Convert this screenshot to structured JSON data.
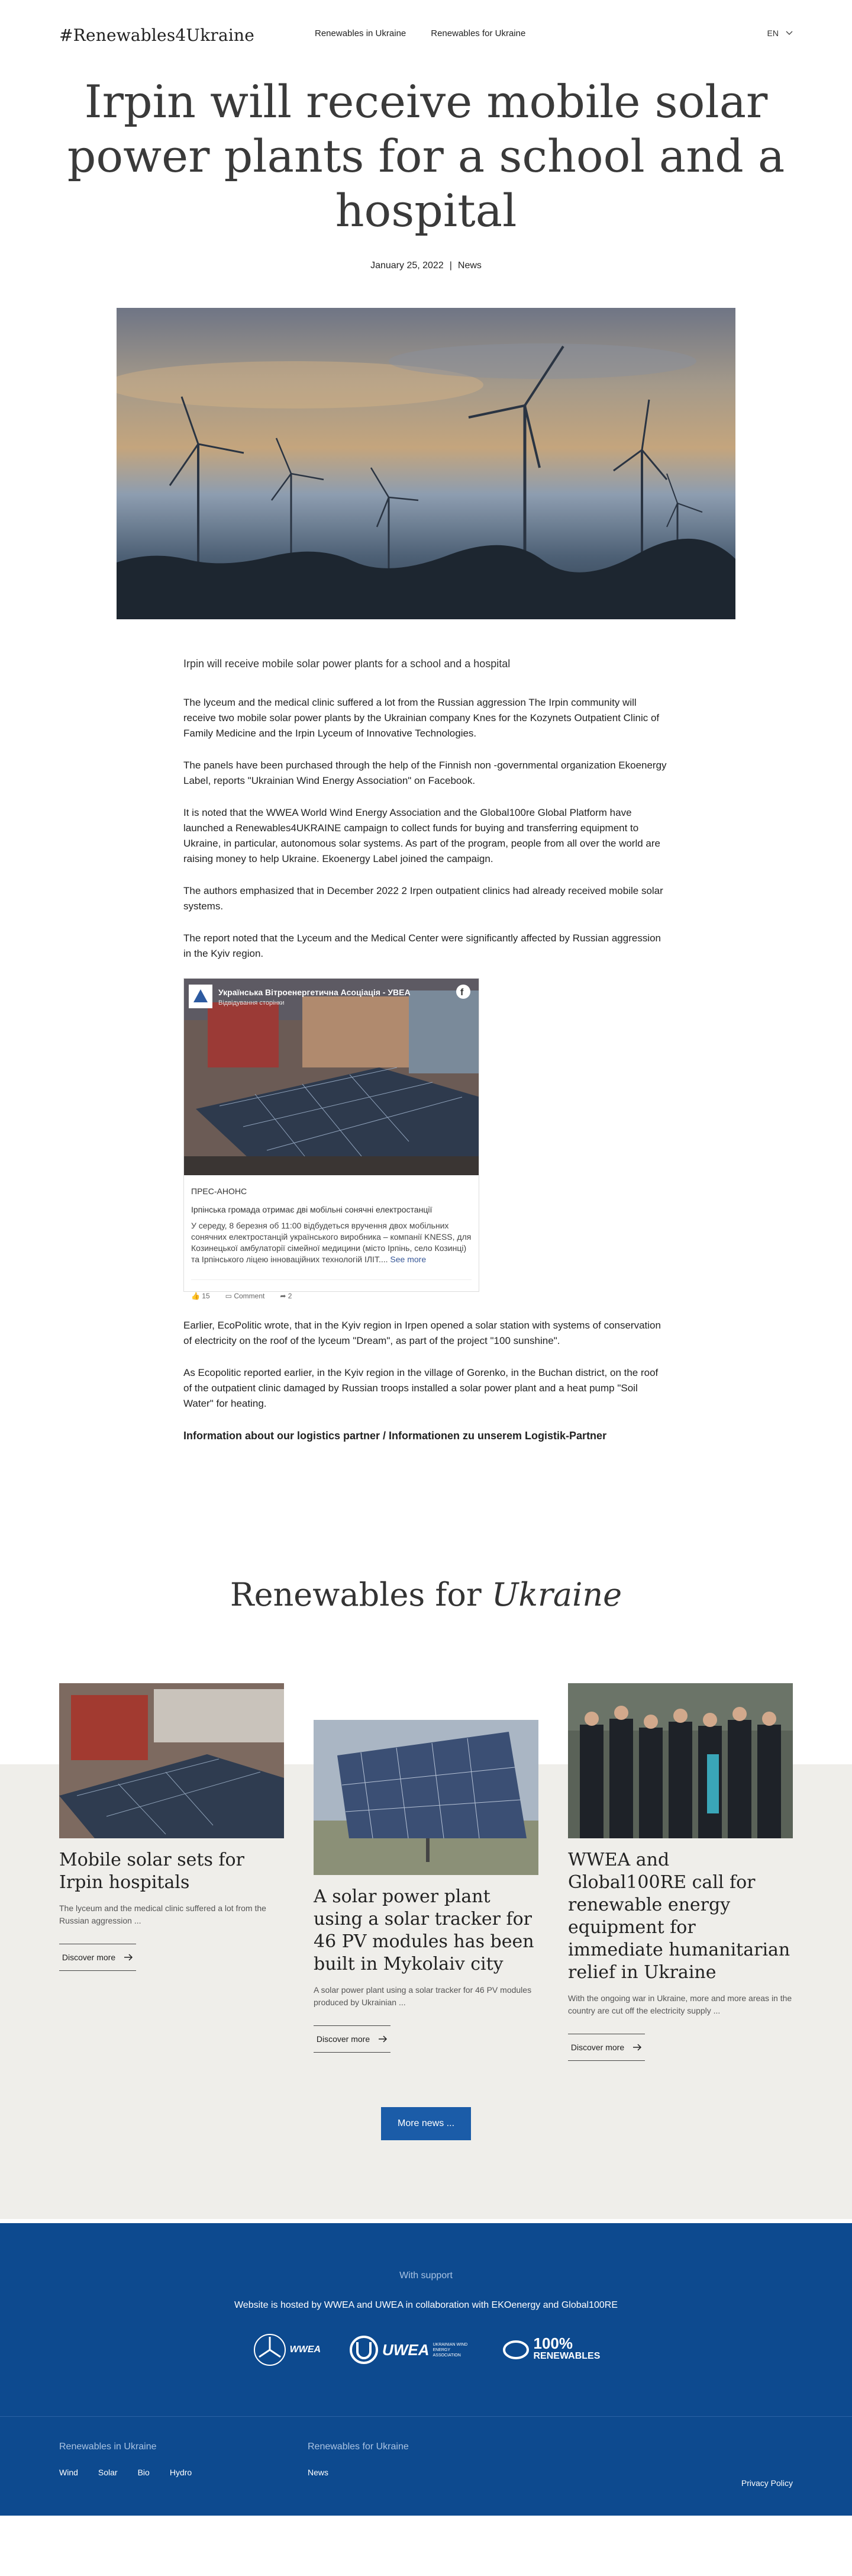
{
  "header": {
    "logo": "#Renewables4Ukraine",
    "nav": [
      "Renewables in Ukraine",
      "Renewables for Ukraine"
    ],
    "lang": "EN"
  },
  "article": {
    "title": "Irpin will receive mobile solar power plants for a school and a hospital",
    "date": "January 25, 2022",
    "category": "News",
    "lead": "Irpin will receive mobile solar power plants for a school and a hospital",
    "paragraphs": [
      "The lyceum and the medical clinic suffered a lot from the Russian aggression The Irpin community will receive two mobile solar power plants by the Ukrainian company Knes for the Kozynets Outpatient Clinic of Family Medicine and the Irpin Lyceum of Innovative Technologies.",
      "The panels have been purchased through the help of the Finnish non -governmental organization Ekoenergy Label, reports \"Ukrainian Wind Energy Association\" on Facebook.",
      "It is noted that the WWEA World Wind Energy Association and the Global100re Global Platform have launched a Renewables4UKRAINE campaign to collect funds for buying and transferring equipment to Ukraine, in particular, autonomous solar systems. As part of the program, people from all over the world are raising money to help Ukraine. Ekoenergy Label joined the campaign.",
      "The authors emphasized that in December 2022 2 Irpen outpatient clinics had already received mobile solar systems.",
      "The report noted that the Lyceum and the Medical Center were significantly affected by Russian aggression in the Kyiv region."
    ],
    "paragraphs_after": [
      "Earlier, EcoPolitic wrote, that in the Kyiv region in Irpen opened a solar station with systems of conservation of electricity on the roof of the lyceum \"Dream\", as part of the project \"100 sunshine\".",
      "As Ecopolitic reported earlier, in the Kyiv region in the village of Gorenko, in the Buchan district, on the roof of the outpatient clinic damaged by Russian troops installed a solar power plant and a heat pump \"Soil Water\" for heating."
    ],
    "partner": "Information about our logistics partner / Informationen zu unserem Logistik-Partner"
  },
  "facebook": {
    "page": "Українська Вітроенергетична Асоціація - УВЕА",
    "sub": "Відвідування сторінки",
    "tag": "ПРЕС-АНОНС",
    "headline": "Ірпінська громада отримає дві мобільні сонячні електростанції",
    "text": "У середу, 8 березня об 11:00 відбудеться вручення двох мобільних сонячних електростанцій українського виробника – компанії KNESS, для Козинецької амбулаторії сімейної медицини (місто Ірпінь, село Козинці) та Ірпінського ліцею інноваційних технологій ІЛІТ....",
    "see_more": "See more",
    "likes": "15",
    "comment": "Comment",
    "shares": "2"
  },
  "renewables": {
    "title_plain": "Renewables for",
    "title_italic": "Ukraine",
    "cards": [
      {
        "title": "Mobile solar sets for Irpin hospitals",
        "excerpt": "The lyceum and the medical clinic suffered a lot from the Russian aggression ...",
        "cta": "Discover more"
      },
      {
        "title": "A solar power plant using a solar tracker for 46 PV modules has been built in Mykolaiv city",
        "excerpt": "A solar power plant using a solar tracker for 46 PV modules produced by Ukrainian ...",
        "cta": "Discover more"
      },
      {
        "title": "WWEA and Global100RE call for renewable energy equipment for immediate humanitarian relief in Ukraine",
        "excerpt": "With the ongoing war in Ukraine, more and more areas in the country are cut off the electricity supply ...",
        "cta": "Discover more"
      }
    ],
    "more": "More news ..."
  },
  "support": {
    "label": "With support",
    "hosted": "Website is hosted by WWEA and UWEA in collaboration with EKOenergy and Global100RE",
    "logos": {
      "wwea": "WWEA",
      "uwea": "UWEA",
      "uwea_sub": "UKRAINIAN WIND ENERGY ASSOCIATION",
      "re100_top": "100%",
      "re100_bottom": "RENEWABLES"
    }
  },
  "footer": {
    "col1_title": "Renewables in Ukraine",
    "col1_links": [
      "Wind",
      "Solar",
      "Bio",
      "Hydro"
    ],
    "col2_title": "Renewables for Ukraine",
    "col2_links": [
      "News"
    ],
    "privacy": "Privacy Policy"
  }
}
